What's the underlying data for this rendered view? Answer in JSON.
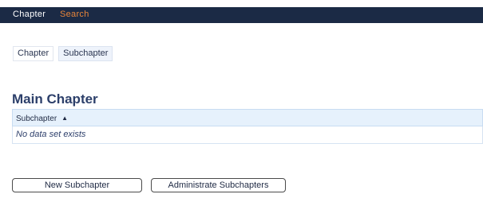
{
  "topnav": {
    "chapter": "Chapter",
    "search": "Search"
  },
  "subtabs": {
    "items": [
      {
        "label": "Chapter"
      },
      {
        "label": "Subchapter"
      }
    ]
  },
  "main": {
    "title": "Main Chapter",
    "grid": {
      "column_header": "Subchapter",
      "sort_indicator": "▲",
      "empty_message": "No data set exists"
    }
  },
  "actions": {
    "new_label": "New Subchapter",
    "admin_label": "Administrate Subchapters"
  },
  "colors": {
    "topbar_bg": "#1b2a45",
    "active_nav": "#e8853a",
    "grid_header_bg": "#e6f1fc"
  }
}
